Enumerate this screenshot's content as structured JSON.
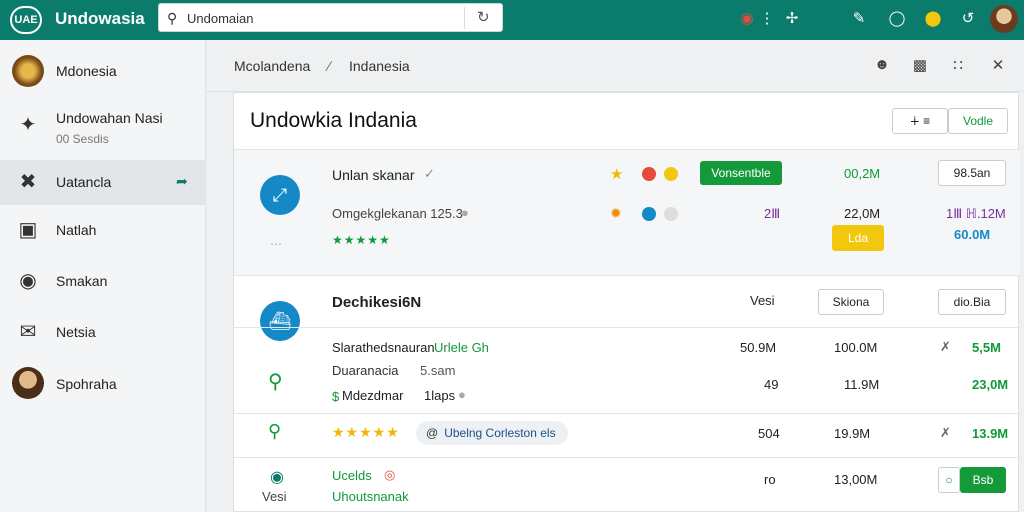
{
  "app": {
    "logo_text": "UAE",
    "title": "Undowasia"
  },
  "search": {
    "value": "Undomaian",
    "placeholder": ""
  },
  "top_icons": [
    "shield-icon",
    "more-vert-icon",
    "puzzle-icon",
    "pen-icon",
    "circle-icon",
    "colorful-app-icon",
    "sync-icon"
  ],
  "sidebar": {
    "items": [
      {
        "label": "Mdonesia",
        "sub": ""
      },
      {
        "label": "Undowahan Nasi",
        "sub": "00 Sesdis"
      },
      {
        "label": "Uatancla",
        "sub": ""
      },
      {
        "label": "Natlah",
        "sub": ""
      },
      {
        "label": "Smakan",
        "sub": ""
      },
      {
        "label": "Netsia",
        "sub": ""
      },
      {
        "label": "Spohraha",
        "sub": ""
      }
    ]
  },
  "breadcrumb": {
    "items": [
      "Mcolandena",
      "Indanesia"
    ]
  },
  "panel": {
    "title": "Undowkia Indania",
    "header_button": "Vodle"
  },
  "row1": {
    "name": "Unlan skanar",
    "badge": "Vonsentble",
    "size": "00,2M",
    "button": "98.5an",
    "line2": "Omgekglekanan 125.3",
    "rating_label": "★★★★★",
    "val_a": "2Ⅲ",
    "val_b": "22,0M",
    "val_c": "1Ⅲ ℍ.12M",
    "val_d": "60.0M",
    "yellow_badge": "Lda"
  },
  "row2": {
    "name": "Dechikesi6N",
    "label_vesi": "Vesi",
    "button_a": "Skiona",
    "button_b": "dio.Bia"
  },
  "row3": {
    "text": "Slarathedsnauran",
    "text_green": "Urlele Gh",
    "c1": "50.9M",
    "c2": "100.0M",
    "c3": "5,5M"
  },
  "row4": {
    "text": "Duaranacia",
    "text2": "5.sam",
    "c1": "49",
    "c2": "11.9M",
    "c3": "23,0M"
  },
  "row5": {
    "text": "Mdezdmar",
    "text2": "1laps"
  },
  "row6": {
    "stars": "★★★★★",
    "pill": "Ubelng Corleston els",
    "c1": "504",
    "c2": "19.9M",
    "c3": "13.9M"
  },
  "row7": {
    "name": "Ucelds",
    "name2": "Uhoutsnanak",
    "left_label": "Vesi",
    "c1": "ro",
    "c2": "13,00M",
    "button": "Bsb"
  }
}
